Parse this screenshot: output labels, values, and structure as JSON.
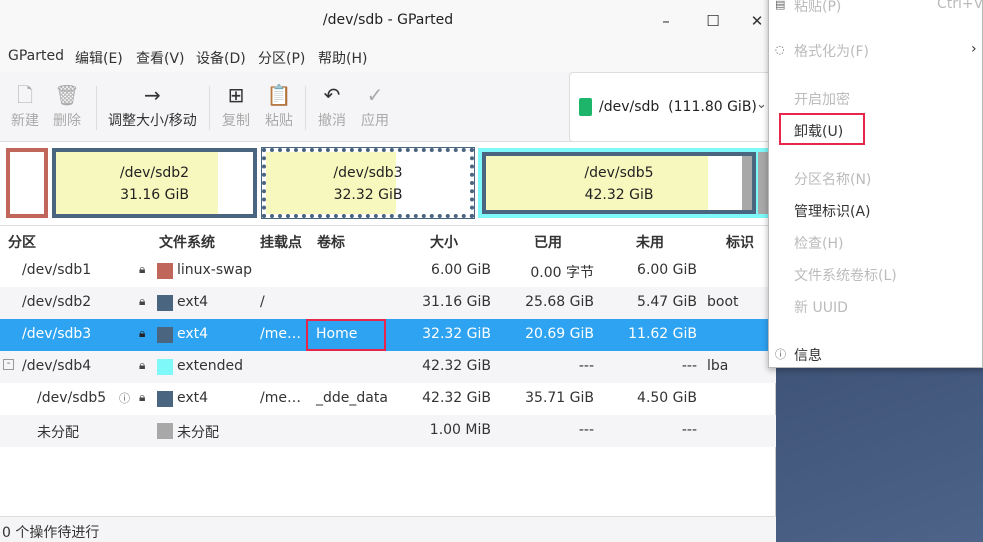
{
  "window": {
    "title": "/dev/sdb - GParted",
    "minimize": "–",
    "maximize": "☐",
    "close": "✕"
  },
  "menubar": [
    "GParted",
    "编辑(E)",
    "查看(V)",
    "设备(D)",
    "分区(P)",
    "帮助(H)"
  ],
  "toolbar": {
    "new": "新建",
    "delete": "删除",
    "resize": "调整大小/移动",
    "copy": "复制",
    "paste": "粘贴",
    "undo": "撤消",
    "apply": "应用",
    "device": "/dev/sdb  (111.80 GiB)"
  },
  "diskbar": [
    {
      "name": "/dev/sdb2",
      "size": "31.16 GiB"
    },
    {
      "name": "/dev/sdb3",
      "size": "32.32 GiB"
    },
    {
      "name": "/dev/sdb5",
      "size": "42.32 GiB"
    }
  ],
  "columns": [
    "分区",
    "文件系统",
    "挂载点",
    "卷标",
    "大小",
    "已用",
    "未用",
    "标识"
  ],
  "rows": [
    {
      "part": "/dev/sdb1",
      "fs": "linux-swap",
      "mount": "",
      "label": "",
      "size": "6.00 GiB",
      "used": "0.00 字节",
      "free": "6.00 GiB",
      "flags": "",
      "color": "#c0665a"
    },
    {
      "part": "/dev/sdb2",
      "fs": "ext4",
      "mount": "/",
      "label": "",
      "size": "31.16 GiB",
      "used": "25.68 GiB",
      "free": "5.47 GiB",
      "flags": "boot",
      "color": "#4a6580"
    },
    {
      "part": "/dev/sdb3",
      "fs": "ext4",
      "mount": "/me…",
      "label": "Home",
      "size": "32.32 GiB",
      "used": "20.69 GiB",
      "free": "11.62 GiB",
      "flags": "",
      "color": "#4a6580"
    },
    {
      "part": "/dev/sdb4",
      "fs": "extended",
      "mount": "",
      "label": "",
      "size": "42.32 GiB",
      "used": "---",
      "free": "---",
      "flags": "lba",
      "color": "#7ef8f8"
    },
    {
      "part": "/dev/sdb5",
      "fs": "ext4",
      "mount": "/me…",
      "label": "_dde_data",
      "size": "42.32 GiB",
      "used": "35.71 GiB",
      "free": "4.50 GiB",
      "flags": "",
      "color": "#4a6580"
    },
    {
      "part": "未分配",
      "fs": "未分配",
      "mount": "",
      "label": "",
      "size": "1.00 MiB",
      "used": "---",
      "free": "---",
      "flags": "",
      "color": "#a8a8a8"
    }
  ],
  "status": "0 个操作待进行",
  "context_menu": {
    "paste": "粘贴(P)",
    "paste_shortcut": "Ctrl+V",
    "format": "格式化为(F)",
    "encrypt": "开启加密",
    "unmount": "卸载(U)",
    "name": "分区名称(N)",
    "flags": "管理标识(A)",
    "check": "检查(H)",
    "fslabel": "文件系统卷标(L)",
    "uuid": "新 UUID",
    "info": "信息"
  }
}
